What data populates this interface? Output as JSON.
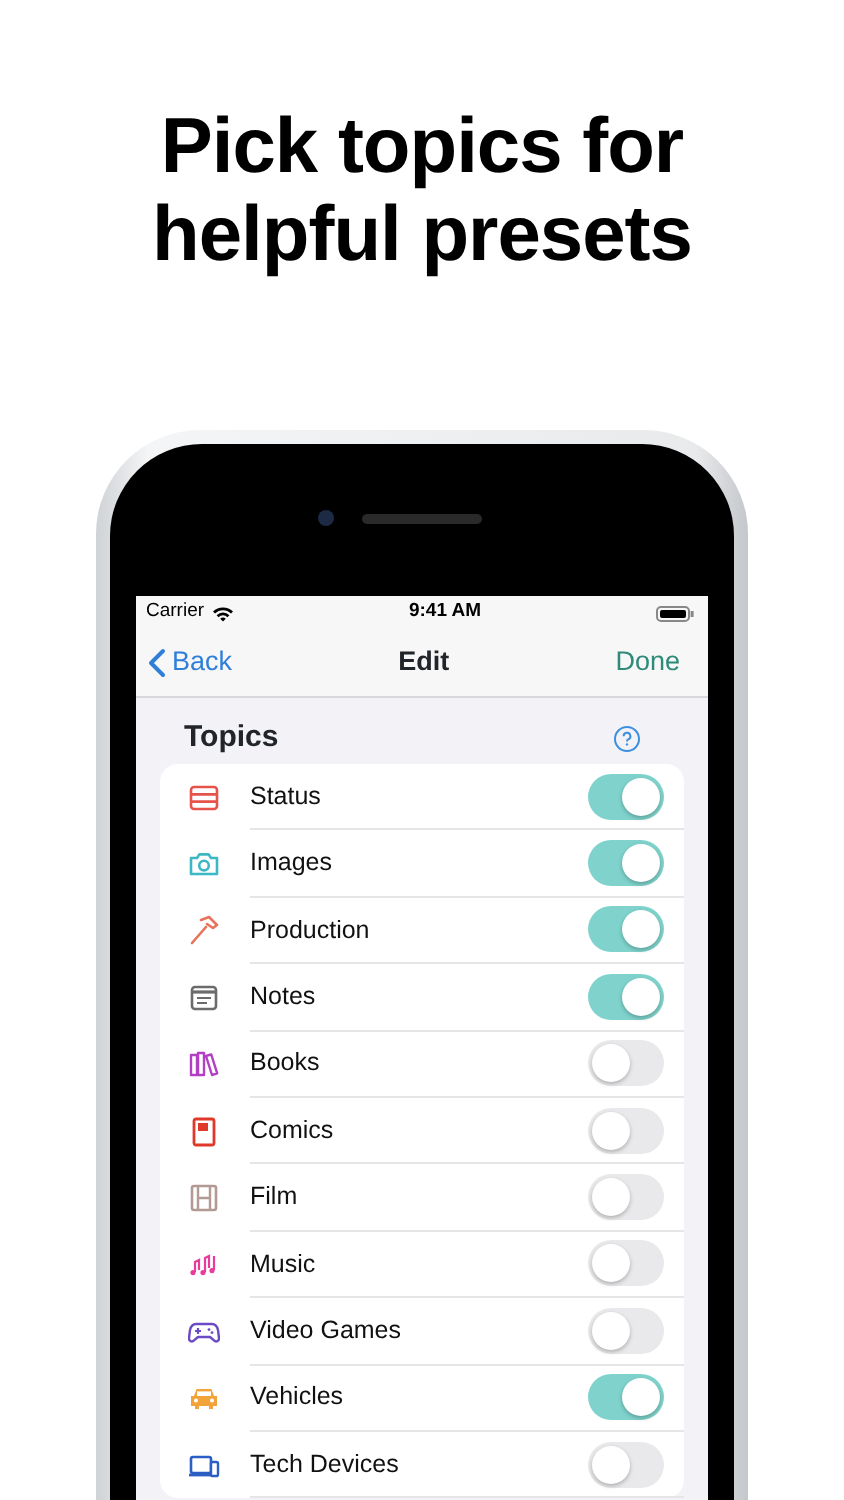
{
  "headline": "Pick topics for helpful presets",
  "status_bar": {
    "carrier": "Carrier",
    "time": "9:41 AM"
  },
  "nav_bar": {
    "back": "Back",
    "title": "Edit",
    "done": "Done"
  },
  "section": {
    "title": "Topics"
  },
  "topics": [
    {
      "label": "Status",
      "kind": "stack",
      "color": "#e5534b",
      "on": true
    },
    {
      "label": "Images",
      "kind": "camera",
      "color": "#3bb8c4",
      "on": true
    },
    {
      "label": "Production",
      "kind": "hammer",
      "color": "#e8735a",
      "on": true
    },
    {
      "label": "Notes",
      "kind": "note",
      "color": "#6b6b6b",
      "on": true
    },
    {
      "label": "Books",
      "kind": "books",
      "color": "#b23fc4",
      "on": false
    },
    {
      "label": "Comics",
      "kind": "comic",
      "color": "#e0392b",
      "on": false
    },
    {
      "label": "Film",
      "kind": "film",
      "color": "#b49a94",
      "on": false
    },
    {
      "label": "Music",
      "kind": "music",
      "color": "#e83c9a",
      "on": false
    },
    {
      "label": "Video Games",
      "kind": "gamepad",
      "color": "#6b4bc4",
      "on": false
    },
    {
      "label": "Vehicles",
      "kind": "car",
      "color": "#f2a33a",
      "on": true
    },
    {
      "label": "Tech Devices",
      "kind": "devices",
      "color": "#2b5fc4",
      "on": false
    }
  ]
}
